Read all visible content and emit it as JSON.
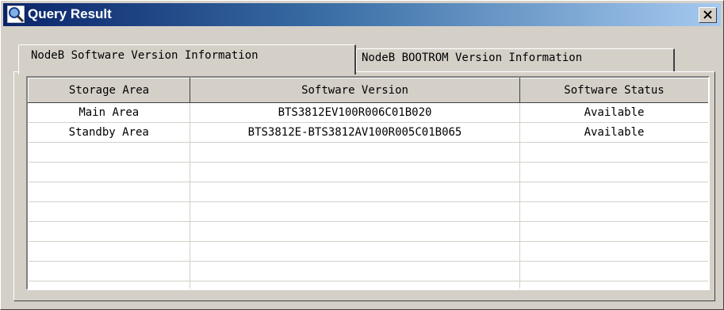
{
  "window": {
    "title": "Query Result",
    "title_icon": "magnifier-icon",
    "close_icon": "close-icon",
    "titlebar_color": "#0a246a"
  },
  "tabs": [
    {
      "label": "NodeB Software Version Information",
      "active": true
    },
    {
      "label": "NodeB BOOTROM Version Information",
      "active": false
    }
  ],
  "table": {
    "columns": [
      "Storage Area",
      "Software Version",
      "Software Status"
    ],
    "rows": [
      [
        "Main Area",
        "BTS3812EV100R006C01B020",
        "Available"
      ],
      [
        "Standby Area",
        "BTS3812E-BTS3812AV100R005C01B065",
        "Available"
      ],
      [
        "",
        "",
        ""
      ],
      [
        "",
        "",
        ""
      ],
      [
        "",
        "",
        ""
      ],
      [
        "",
        "",
        ""
      ],
      [
        "",
        "",
        ""
      ],
      [
        "",
        "",
        ""
      ],
      [
        "",
        "",
        ""
      ],
      [
        "",
        "",
        ""
      ]
    ]
  }
}
